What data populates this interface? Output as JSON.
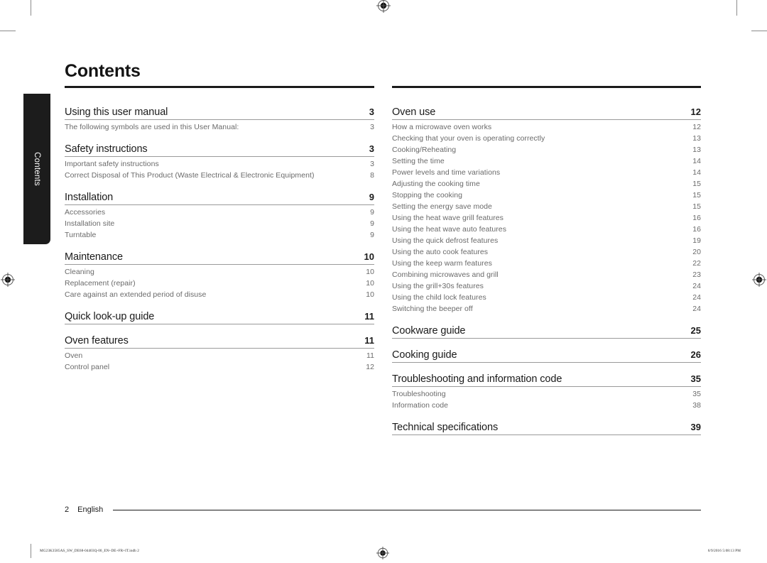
{
  "document": {
    "title": "Contents",
    "side_tab_label": "Contents"
  },
  "footer": {
    "page_number": "2",
    "language": "English"
  },
  "print_slug": {
    "file_name": "MG23K3585AS_SW_DE68-04403Q-00_EN+DE+FR+IT.indb   2",
    "timestamp": "6/9/2016   5:08:13 PM"
  },
  "toc": {
    "left_column": [
      {
        "title": "Using this user manual",
        "page": "3",
        "entries": [
          {
            "label": "The following symbols are used in this User Manual:",
            "page": "3"
          }
        ]
      },
      {
        "title": "Safety instructions",
        "page": "3",
        "entries": [
          {
            "label": "Important safety instructions",
            "page": "3"
          },
          {
            "label": "Correct Disposal of This Product (Waste Electrical & Electronic Equipment)",
            "page": "8"
          }
        ]
      },
      {
        "title": "Installation",
        "page": "9",
        "entries": [
          {
            "label": "Accessories",
            "page": "9"
          },
          {
            "label": "Installation site",
            "page": "9"
          },
          {
            "label": "Turntable",
            "page": "9"
          }
        ]
      },
      {
        "title": "Maintenance",
        "page": "10",
        "entries": [
          {
            "label": "Cleaning",
            "page": "10"
          },
          {
            "label": "Replacement (repair)",
            "page": "10"
          },
          {
            "label": "Care against an extended period of disuse",
            "page": "10"
          }
        ]
      },
      {
        "title": "Quick look-up guide",
        "page": "11",
        "entries": []
      },
      {
        "title": "Oven features",
        "page": "11",
        "entries": [
          {
            "label": "Oven",
            "page": "11"
          },
          {
            "label": "Control panel",
            "page": "12"
          }
        ]
      }
    ],
    "right_column": [
      {
        "title": "Oven use",
        "page": "12",
        "entries": [
          {
            "label": "How a microwave oven works",
            "page": "12"
          },
          {
            "label": "Checking that your oven is operating correctly",
            "page": "13"
          },
          {
            "label": "Cooking/Reheating",
            "page": "13"
          },
          {
            "label": "Setting the time",
            "page": "14"
          },
          {
            "label": "Power levels and time variations",
            "page": "14"
          },
          {
            "label": "Adjusting the cooking time",
            "page": "15"
          },
          {
            "label": "Stopping the cooking",
            "page": "15"
          },
          {
            "label": "Setting the energy save mode",
            "page": "15"
          },
          {
            "label": "Using the heat wave grill features",
            "page": "16"
          },
          {
            "label": "Using the heat wave auto features",
            "page": "16"
          },
          {
            "label": "Using the quick defrost features",
            "page": "19"
          },
          {
            "label": "Using the auto cook features",
            "page": "20"
          },
          {
            "label": "Using the keep warm features",
            "page": "22"
          },
          {
            "label": "Combining microwaves and grill",
            "page": "23"
          },
          {
            "label": "Using the grill+30s features",
            "page": "24"
          },
          {
            "label": "Using the child lock features",
            "page": "24"
          },
          {
            "label": "Switching the beeper off",
            "page": "24"
          }
        ]
      },
      {
        "title": "Cookware guide",
        "page": "25",
        "entries": []
      },
      {
        "title": "Cooking guide",
        "page": "26",
        "entries": []
      },
      {
        "title": "Troubleshooting and information code",
        "page": "35",
        "entries": [
          {
            "label": "Troubleshooting",
            "page": "35"
          },
          {
            "label": "Information code",
            "page": "38"
          }
        ]
      },
      {
        "title": "Technical specifications",
        "page": "39",
        "entries": []
      }
    ]
  }
}
